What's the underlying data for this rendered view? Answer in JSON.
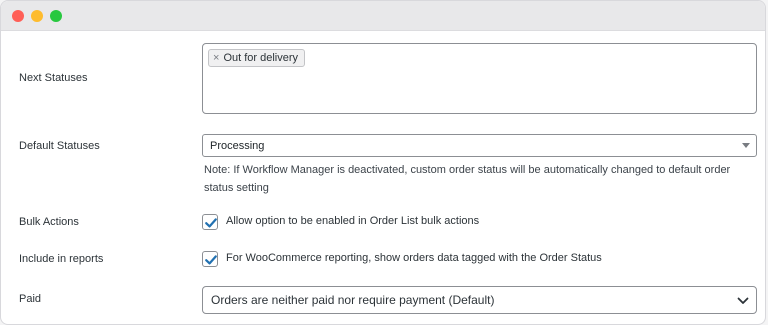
{
  "form": {
    "next_statuses": {
      "label": "Next Statuses",
      "tags": [
        {
          "label": "Out for delivery",
          "remove": "×"
        }
      ]
    },
    "default_statuses": {
      "label": "Default Statuses",
      "value": "Processing",
      "note": "Note: If Workflow Manager is deactivated, custom order status will be automatically changed to default order status setting"
    },
    "bulk_actions": {
      "label": "Bulk Actions",
      "checked": true,
      "text": "Allow option to be enabled in Order List bulk actions"
    },
    "include_in_reports": {
      "label": "Include in reports",
      "checked": true,
      "text": "For WooCommerce reporting, show orders data tagged with the Order Status"
    },
    "paid": {
      "label": "Paid",
      "value": "Orders are neither paid nor require payment (Default)"
    }
  },
  "colors": {
    "accent": "#2271b1",
    "close": "#ff5f57",
    "minimize": "#febc2e",
    "maximize": "#28c840"
  }
}
